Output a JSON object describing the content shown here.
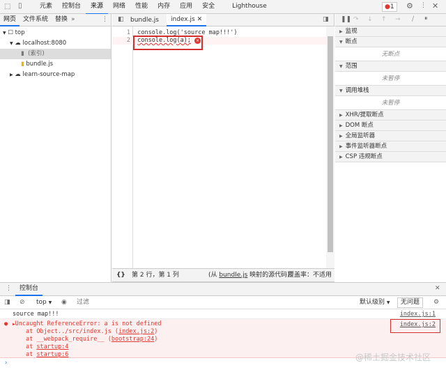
{
  "top_tabs": [
    "元素",
    "控制台",
    "来源",
    "网络",
    "性能",
    "内存",
    "应用",
    "安全",
    "Lighthouse"
  ],
  "active_top_tab": "来源",
  "error_badge": "1",
  "nav_tabs": [
    "网页",
    "文件系统",
    "替换"
  ],
  "tree": {
    "top": "top",
    "host": "localhost:8080",
    "index": "(索引)",
    "bundle": "bundle.js",
    "other": "learn-source-map"
  },
  "editor_tabs": [
    "bundle.js",
    "index.js"
  ],
  "code": [
    {
      "n": "1",
      "text": "console.log('source map!!!')"
    },
    {
      "n": "2",
      "text": "console.log(a);"
    }
  ],
  "status": {
    "pos": "第 2 行，第 1 列",
    "from_prefix": "(从 ",
    "from_link": "bundle.js",
    "from_suffix": " 映射的源代码)",
    "coverage": "覆盖率：不适用"
  },
  "debugger": {
    "watch": "监视",
    "breakpoints": "断点",
    "no_breakpoints": "无断点",
    "scope": "范围",
    "not_paused": "未暂停",
    "callstack": "调用堆栈",
    "not_paused2": "未暂停",
    "xhr": "XHR/提取断点",
    "dom": "DOM 断点",
    "global": "全局监听器",
    "event": "事件监听器断点",
    "csp": "CSP 违规断点"
  },
  "drawer": {
    "tab": "控制台",
    "context": "top",
    "filter_placeholder": "过滤",
    "level": "默认级别",
    "issues": "无问题"
  },
  "console": {
    "log": {
      "text": "source map!!!",
      "src": "index.js:1"
    },
    "error": {
      "text": "Uncaught ReferenceError: a is not defined",
      "src": "index.js:2",
      "stack": [
        {
          "pre": "at Object../src/index.js (",
          "link": "index.js:2",
          "post": ")"
        },
        {
          "pre": "at __webpack_require__ (",
          "link": "bootstrap:24",
          "post": ")"
        },
        {
          "pre": "at ",
          "link": "startup:4",
          "post": ""
        },
        {
          "pre": "at ",
          "link": "startup:6",
          "post": ""
        }
      ]
    },
    "prompt": "›"
  },
  "watermark": "@稀土掘金技术社区",
  "colors": {
    "accent": "#1a73e8",
    "error": "#e0382f",
    "error_bg": "#fdf0f0",
    "highlight_box": "#d32f2f"
  }
}
